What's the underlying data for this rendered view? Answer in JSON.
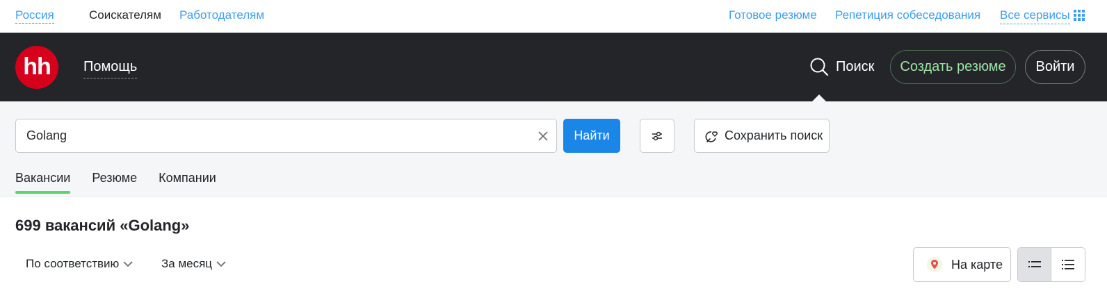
{
  "topbar": {
    "region": "Россия",
    "seekers": "Соискателям",
    "employers": "Работодателям",
    "ready_resume": "Готовое резюме",
    "interview_rehearsal": "Репетиция собеседования",
    "all_services": "Все сервисы"
  },
  "header": {
    "logo": "hh",
    "help": "Помощь",
    "search": "Поиск",
    "create_resume": "Создать резюме",
    "login": "Войти"
  },
  "search": {
    "value": "Golang",
    "find_button": "Найти",
    "save_search": "Сохранить поиск"
  },
  "tabs": [
    {
      "label": "Вакансии",
      "active": true
    },
    {
      "label": "Резюме",
      "active": false
    },
    {
      "label": "Компании",
      "active": false
    }
  ],
  "results": {
    "title": "699 вакансий «Golang»",
    "sort_relevance": "По соответствию",
    "sort_period": "За месяц",
    "map_button": "На карте"
  },
  "colors": {
    "accent_blue": "#1a86e8",
    "link_blue": "#3c9df2",
    "header_dark": "#232529",
    "logo_red": "#d6001c",
    "tab_green": "#5ed46f"
  }
}
